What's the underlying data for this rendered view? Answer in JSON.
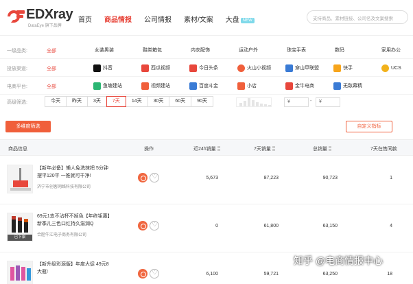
{
  "logo": {
    "brand": "EDXray",
    "sub": "DataEye 旗下品牌"
  },
  "nav": [
    {
      "label": "首页",
      "active": false
    },
    {
      "label": "商品情报",
      "active": true
    },
    {
      "label": "公司情报",
      "active": false
    },
    {
      "label": "素材/文案",
      "active": false
    },
    {
      "label": "大盘",
      "active": false,
      "badge": "NEW"
    }
  ],
  "search": {
    "placeholder": "支持商品、素材链接、公司名及文案搜索"
  },
  "filters": {
    "category": {
      "label": "一级品类:",
      "all": "全部",
      "options": [
        "女装男装",
        "鞋类箱包",
        "内衣配饰",
        "运动户外",
        "珠宝手表",
        "数码",
        "家用办公"
      ]
    },
    "platform": {
      "label": "投放渠道:",
      "all": "全部",
      "options": [
        {
          "name": "抖音",
          "color": "#111111"
        },
        {
          "name": "西瓜视频",
          "color": "#e8473c"
        },
        {
          "name": "今日头条",
          "color": "#e8473c"
        },
        {
          "name": "火山小视频",
          "color": "#f05f3b"
        },
        {
          "name": "穿山甲联盟",
          "color": "#3a7bd5"
        },
        {
          "name": "快手",
          "color": "#f7a51c"
        },
        {
          "name": "UCS",
          "color": "#f2b21b"
        }
      ]
    },
    "ecommerce": {
      "label": "电商平台:",
      "all": "全部",
      "options": [
        {
          "name": "鱼塘建站",
          "color": "#2bb673"
        },
        {
          "name": "视频建站",
          "color": "#f05f3b"
        },
        {
          "name": "百度斗金",
          "color": "#3a7bd5"
        },
        {
          "name": "小店",
          "color": "#f05f3b"
        },
        {
          "name": "金牛电商",
          "color": "#e8473c"
        },
        {
          "name": "无敌幕精",
          "color": "#3a7bd5"
        }
      ]
    },
    "advanced": {
      "label": "高级筛选:",
      "time_buttons": [
        "今天",
        "昨天",
        "3天",
        "7天",
        "14天",
        "30天",
        "60天",
        "90天"
      ],
      "active_time": "7天",
      "price_min": "¥",
      "price_max": "¥",
      "price_sep": "-"
    }
  },
  "actions": {
    "sync_label": "多维度筛选",
    "custom_label": "自定义指标"
  },
  "table": {
    "headers": {
      "info": "商品信息",
      "ops": "操作",
      "sales24": "近24h销量",
      "sales7": "7天销量",
      "total": "总销量",
      "ads7": "7天在售同款"
    },
    "rows": [
      {
        "title": "【新年必备】懒人免洗抹把 5分钟摆平120平 一推就可干净!",
        "shop": "济宁市创客网络科技有限公司",
        "sales24": "5,673",
        "sales7": "87,223",
        "total": "90,723",
        "ads7": "1",
        "tag": ""
      },
      {
        "title": "69元1支不沾杯不掉色【年终钜惠】新季儿三色口红持久滋润Q",
        "shop": "合肥牛汇电子商务有限公司",
        "sales24": "0",
        "sales7": "61,800",
        "total": "63,150",
        "ads7": "4",
        "tag": "已下架"
      },
      {
        "title": "【新升级彩源版】年度大促 49元8大瓶!",
        "shop": "",
        "sales24": "6,100",
        "sales7": "59,721",
        "total": "63,250",
        "ads7": "18",
        "tag": ""
      }
    ]
  },
  "watermark": "知乎 @电商情报中心"
}
